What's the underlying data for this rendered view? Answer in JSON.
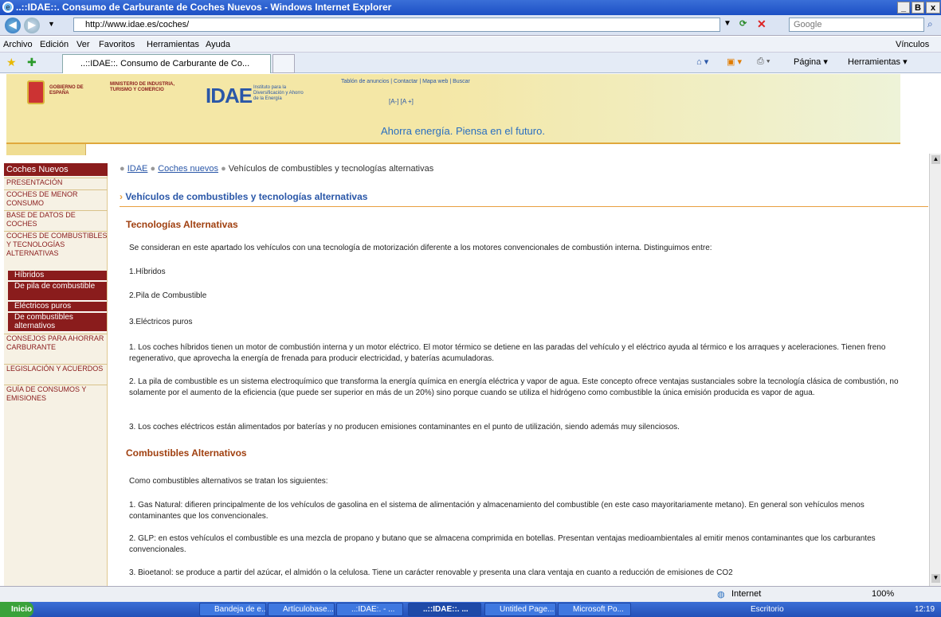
{
  "window": {
    "title": "..::IDAE::. Consumo de Carburante de Coches Nuevos - Windows Internet Explorer",
    "min": "_",
    "max": "B",
    "close": "x"
  },
  "address": {
    "url": "http://www.idae.es/coches/",
    "search_placeholder": "Google"
  },
  "menu": {
    "items": [
      "Archivo",
      "Edición",
      "Ver",
      "Favoritos",
      "Herramientas",
      "Ayuda"
    ],
    "links": "Vínculos"
  },
  "tab": {
    "label": "..::IDAE::. Consumo de Carburante de Co..."
  },
  "commands": {
    "page": "Página",
    "tools": "Herramientas"
  },
  "banner": {
    "gov": "GOBIERNO DE ESPAÑA",
    "ministry": "MINISTERIO DE INDUSTRIA, TURISMO Y COMERCIO",
    "logo": "IDAE",
    "logo_sub": "Instituto para la Diversificación y Ahorro de la Energía",
    "top_links": "Tablón de anuncios | Contactar | Mapa web | Buscar",
    "font_size": "[A-]  [A +]",
    "slogan": "Ahorra energía. Piensa en el futuro."
  },
  "sidebar": {
    "header": "Coches Nuevos",
    "items": [
      "Presentación",
      "Coches de menor consumo",
      "Base de datos de coches",
      "Coches de combustibles y tecnologías alternativas"
    ],
    "subitems": [
      "Híbridos",
      "De pila de combustible",
      "Eléctricos puros",
      "De combustibles alternativos"
    ],
    "items2": [
      "Consejos para ahorrar carburante",
      "Legislación y acuerdos",
      "Guía de consumos y emisiones"
    ]
  },
  "breadcrumb": {
    "home": "IDAE",
    "section": "Coches nuevos",
    "current": "Vehículos de combustibles y tecnologías alternativas"
  },
  "content": {
    "title": "Vehículos de combustibles y tecnologías alternativas",
    "sec1": "Tecnologías Alternativas",
    "p1": "Se consideran en este apartado los vehículos con una tecnología de motorización diferente a los motores convencionales de combustión interna. Distinguimos entre:",
    "l1": "1.Híbridos",
    "l2": "2.Pila de Combustible",
    "l3": "3.Eléctricos puros",
    "p2": "1. Los coches híbridos tienen un motor de combustión interna y un motor eléctrico. El motor térmico se detiene en las paradas del vehículo y el eléctrico ayuda al térmico e los arraques y aceleraciones. Tienen freno regenerativo, que aprovecha la energía de frenada para producir electricidad, y baterías acumuladoras.",
    "p3": "2. La pila de combustible es un sistema electroquímico que transforma la energía química en energía eléctrica y vapor de agua. Este concepto ofrece ventajas sustanciales sobre la tecnología clásica de combustión, no solamente por el aumento de la eficiencia (que puede ser superior en más de un 20%) sino porque cuando se utiliza el hidrógeno como combustible la única emisión producida es vapor de agua.",
    "p4": "3. Los coches eléctricos están alimentados por baterías y no producen emisiones contaminantes en el punto de utilización, siendo además muy silenciosos.",
    "sec2": "Combustibles Alternativos",
    "p5": "Como combustibles alternativos se tratan los siguientes:",
    "p6": "1. Gas Natural: difieren principalmente de los vehículos de gasolina en el sistema de alimentación y almacenamiento del combustible (en este caso mayoritariamente metano). En general son vehículos menos contaminantes que los convencionales.",
    "p7": "2. GLP: en estos vehículos el combustible es una mezcla de propano y butano que se almacena comprimida en botellas. Presentan ventajas medioambientales al emitir menos contaminantes que los carburantes convencionales.",
    "p8": "3. Bioetanol: se produce a partir del azúcar, el almidón o la celulosa. Tiene un carácter renovable y presenta una clara ventaja en cuanto a reducción de emisiones de CO2"
  },
  "status": {
    "zone": "Internet",
    "zoom": "100%"
  },
  "taskbar": {
    "start": "Inicio",
    "items": [
      "Bandeja de e...",
      "Artículobase...",
      "..:IDAE:. - ...",
      "..::IDAE::. ...",
      "Untitled Page...",
      "Microsoft Po..."
    ],
    "desktop": "Escritorio",
    "clock": "12:19"
  }
}
